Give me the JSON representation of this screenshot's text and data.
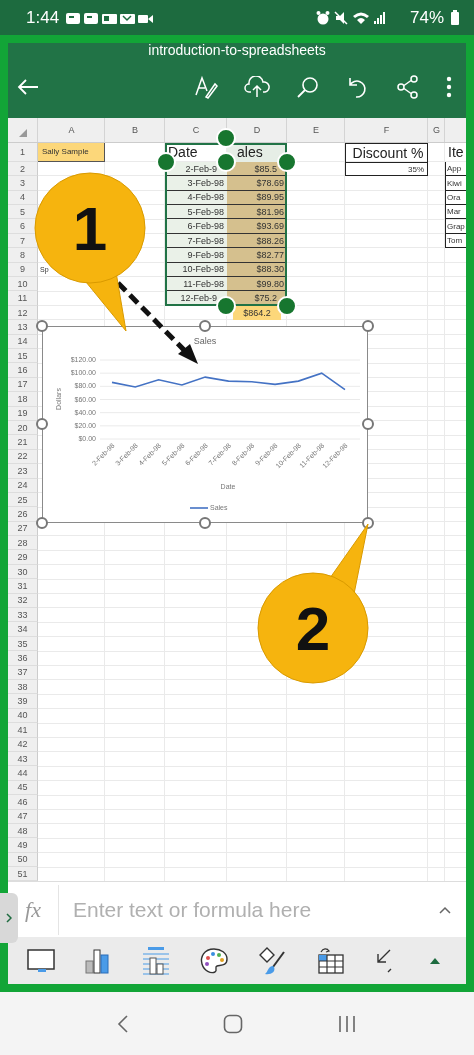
{
  "status_bar": {
    "time": "1:44",
    "battery": "74%"
  },
  "title": "introduction-to-spreadsheets",
  "columns": [
    "A",
    "B",
    "C",
    "D",
    "E",
    "F",
    "G"
  ],
  "rows": [
    {
      "number": "1",
      "cells": {
        "a": {
          "text": "Sally Sample",
          "kind": "name"
        },
        "c": {
          "text": "Date",
          "kind": "header"
        },
        "d": {
          "text": "ales",
          "kind": "header_cut"
        },
        "f": {
          "text": "Discount %",
          "kind": "header_box"
        },
        "h": {
          "text": "Ite",
          "kind": "header"
        }
      }
    },
    {
      "number": "2",
      "cells": {
        "c": {
          "text": "2-Feb-9",
          "kind": "date_cut"
        },
        "d": {
          "text": "$85.5",
          "kind": "amount_cut"
        },
        "f": {
          "text": "35%",
          "kind": "percent"
        },
        "h": {
          "text": "App",
          "kind": "item"
        }
      }
    },
    {
      "number": "3",
      "cells": {
        "c": {
          "text": "3-Feb-98",
          "kind": "date"
        },
        "d": {
          "text": "$78.69",
          "kind": "amount"
        },
        "h": {
          "text": "Kiwi",
          "kind": "item"
        }
      }
    },
    {
      "number": "4",
      "cells": {
        "c": {
          "text": "4-Feb-98",
          "kind": "date"
        },
        "d": {
          "text": "$89.95",
          "kind": "amount"
        },
        "h": {
          "text": "Ora",
          "kind": "item"
        }
      }
    },
    {
      "number": "5",
      "cells": {
        "c": {
          "text": "5-Feb-98",
          "kind": "date"
        },
        "d": {
          "text": "$81.96",
          "kind": "amount"
        },
        "h": {
          "text": "Mar",
          "kind": "item"
        }
      }
    },
    {
      "number": "6",
      "cells": {
        "c": {
          "text": "6-Feb-98",
          "kind": "date"
        },
        "d": {
          "text": "$93.69",
          "kind": "amount"
        },
        "h": {
          "text": "Grap",
          "kind": "item"
        }
      }
    },
    {
      "number": "7",
      "cells": {
        "c": {
          "text": "7-Feb-98",
          "kind": "date"
        },
        "d": {
          "text": "$88.26",
          "kind": "amount"
        },
        "h": {
          "text": "Tom",
          "kind": "item"
        }
      }
    },
    {
      "number": "8",
      "cells": {
        "c": {
          "text": "9-Feb-98",
          "kind": "date"
        },
        "d": {
          "text": "$82.77",
          "kind": "amount"
        }
      }
    },
    {
      "number": "9",
      "cells": {
        "a": {
          "text": "Sp",
          "kind": "note"
        },
        "c": {
          "text": "10-Feb-98",
          "kind": "date"
        },
        "d": {
          "text": "$88.30",
          "kind": "amount"
        }
      }
    },
    {
      "number": "10",
      "cells": {
        "c": {
          "text": "11-Feb-98",
          "kind": "date"
        },
        "d": {
          "text": "$99.80",
          "kind": "amount"
        }
      }
    },
    {
      "number": "11",
      "cells": {
        "c": {
          "text": "12-Feb-9",
          "kind": "date_cut"
        },
        "d": {
          "text": "$75.2",
          "kind": "amount_cut"
        }
      }
    },
    {
      "number": "12",
      "cells": {
        "d": {
          "text": "$864.2",
          "kind": "total"
        }
      }
    },
    {
      "number": "13"
    },
    {
      "number": "14"
    },
    {
      "number": "15"
    },
    {
      "number": "16"
    },
    {
      "number": "17"
    },
    {
      "number": "18"
    },
    {
      "number": "19"
    },
    {
      "number": "20"
    },
    {
      "number": "21"
    },
    {
      "number": "22"
    },
    {
      "number": "23"
    },
    {
      "number": "24"
    },
    {
      "number": "25"
    },
    {
      "number": "26"
    },
    {
      "number": "27"
    },
    {
      "number": "28"
    },
    {
      "number": "29"
    },
    {
      "number": "30"
    },
    {
      "number": "31"
    },
    {
      "number": "32"
    },
    {
      "number": "33"
    },
    {
      "number": "34"
    },
    {
      "number": "35"
    },
    {
      "number": "36"
    },
    {
      "number": "37"
    },
    {
      "number": "38"
    },
    {
      "number": "39"
    },
    {
      "number": "40"
    },
    {
      "number": "41"
    },
    {
      "number": "42"
    },
    {
      "number": "43"
    },
    {
      "number": "44"
    },
    {
      "number": "45"
    },
    {
      "number": "46"
    },
    {
      "number": "47"
    },
    {
      "number": "48"
    },
    {
      "number": "49"
    },
    {
      "number": "50"
    },
    {
      "number": "51"
    }
  ],
  "chart": {
    "chart_data": {
      "type": "line",
      "title": "Sales",
      "xlabel": "Date",
      "ylabel": "Dollars",
      "categories": [
        "2-Feb-98",
        "3-Feb-98",
        "4-Feb-98",
        "5-Feb-98",
        "6-Feb-98",
        "7-Feb-98",
        "8-Feb-98",
        "9-Feb-98",
        "10-Feb-98",
        "11-Feb-98",
        "12-Feb-98"
      ],
      "series": [
        {
          "name": "Sales",
          "color": "#4472c4",
          "values": [
            86,
            79,
            90,
            82,
            94,
            88,
            87,
            83,
            88,
            100,
            75
          ]
        }
      ],
      "grid": true,
      "ylim": [
        0,
        120
      ],
      "yticks": [
        {
          "value": 0,
          "label": "$0.00"
        },
        {
          "value": 20,
          "label": "$20.00"
        },
        {
          "value": 40,
          "label": "$40.00"
        },
        {
          "value": 60,
          "label": "$60.00"
        },
        {
          "value": 80,
          "label": "$80.00"
        },
        {
          "value": 100,
          "label": "$100.00"
        },
        {
          "value": 120,
          "label": "$120.00"
        }
      ]
    }
  },
  "callouts": [
    "1",
    "2"
  ],
  "formula_bar": {
    "label": "fx",
    "placeholder": "Enter text or formula here"
  }
}
